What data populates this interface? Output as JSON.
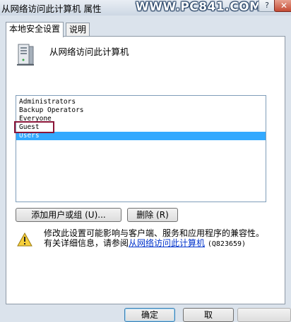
{
  "window": {
    "title": "从网络访问此计算机 属性",
    "watermark": "WWW.PC841.COM",
    "help_label": "?",
    "close_label": "✕"
  },
  "tabs": [
    {
      "label": "本地安全设置",
      "active": true
    },
    {
      "label": "说明",
      "active": false
    }
  ],
  "policy": {
    "name": "从网络访问此计算机",
    "icon": "server-computer-icon"
  },
  "accounts": [
    {
      "name": "Administrators",
      "selected": false
    },
    {
      "name": "Backup Operators",
      "selected": false
    },
    {
      "name": "Everyone",
      "selected": false
    },
    {
      "name": "Guest",
      "selected": false,
      "highlighted": true
    },
    {
      "name": "Users",
      "selected": true
    }
  ],
  "buttons": {
    "add": "添加用户或组 (U)...",
    "remove": "删除 (R)",
    "ok": "确定",
    "cancel": "取",
    "apply": ""
  },
  "notice": {
    "icon": "warning-icon",
    "line1": "修改此设置可能影响与客户端、服务和应用程序的兼容性。",
    "line2_prefix": "有关详细信息，请参阅",
    "link": "从网络访问此计算机",
    "kb": "(Q823659)"
  },
  "colors": {
    "selection": "#33a9ff",
    "highlight_border": "#8b1538",
    "link": "#0033cc"
  }
}
